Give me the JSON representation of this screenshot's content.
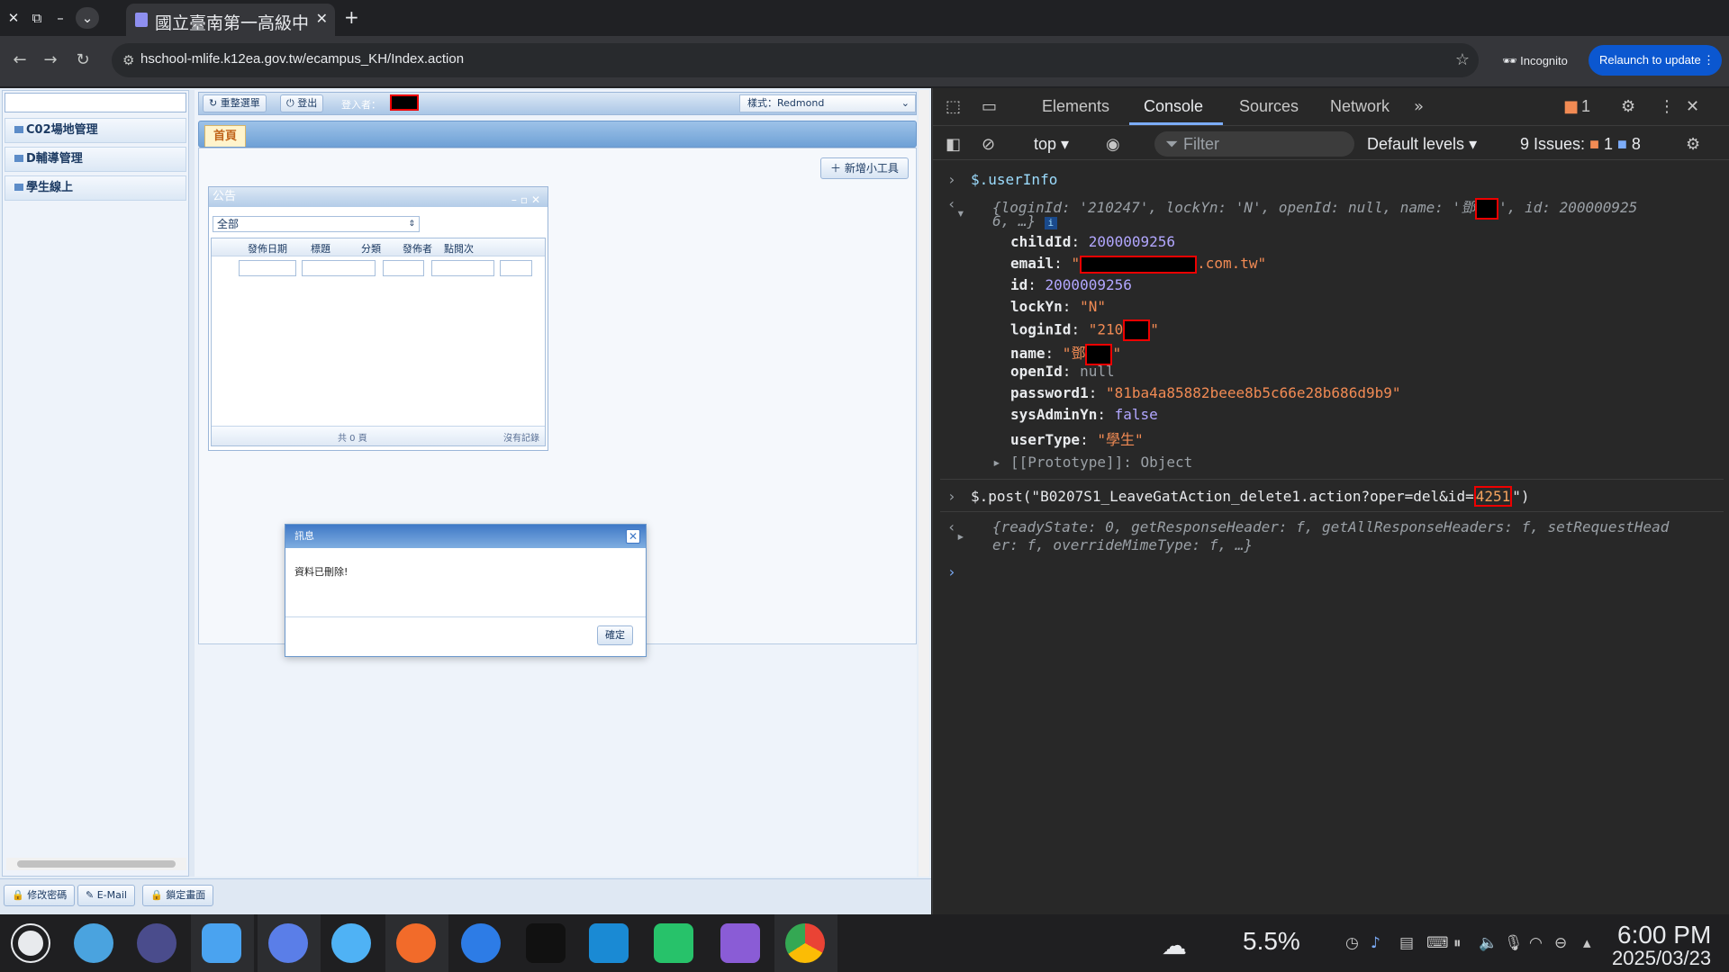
{
  "browser": {
    "tab_title": "國立臺南第一高級中學",
    "url": "hschool-mlife.k12ea.gov.tw/ecampus_KH/Index.action",
    "incognito_label": "Incognito",
    "relaunch_label": "Relaunch to update"
  },
  "page": {
    "left_menu": [
      "C02場地管理",
      "D輔導管理",
      "學生線上"
    ],
    "topbar": {
      "reload_menu": "重整選單",
      "logout": "登出",
      "login_label": "登入者：",
      "style_select": "樣式：Redmond"
    },
    "home_tab": "首頁",
    "add_widget": "新增小工具",
    "announcement": {
      "title": "公告",
      "filter": "全部",
      "columns": [
        "發佈日期",
        "標題",
        "分類",
        "發佈者",
        "點閱次"
      ],
      "pager_text": "共 0 頁",
      "empty_text": "沒有記錄"
    },
    "bottom_buttons": [
      "修改密碼",
      "E-Mail",
      "鎖定畫面"
    ],
    "dialog": {
      "title": "訊息",
      "message": "資料已刪除!",
      "ok": "確定"
    }
  },
  "devtools": {
    "tabs": [
      "Elements",
      "Console",
      "Sources",
      "Network"
    ],
    "context": "top",
    "filter_placeholder": "Filter",
    "levels": "Default levels",
    "issues_label": "9 Issues:",
    "issues_warn": "1",
    "issues_info": "8",
    "header_warn_count": "1",
    "console": {
      "cmd1": "$.userInfo",
      "summary_pre": "{loginId: '210247', lockYn: 'N', openId: null, name: '鄧",
      "summary_post": "', id: 200000925",
      "summary_line2": "6, …}",
      "props": [
        {
          "key": "childId",
          "value": "2000009256",
          "kind": "num"
        },
        {
          "key": "email",
          "value": ".com.tw\"",
          "kind": "email"
        },
        {
          "key": "id",
          "value": "2000009256",
          "kind": "num"
        },
        {
          "key": "lockYn",
          "value": "\"N\"",
          "kind": "str"
        },
        {
          "key": "loginId",
          "value": "\"210",
          "kind": "loginid"
        },
        {
          "key": "name",
          "value": "\"鄧",
          "kind": "name"
        },
        {
          "key": "openId",
          "value": "null",
          "kind": "null"
        },
        {
          "key": "password1",
          "value": "\"81ba4a85882beee8b5c66e28b686d9b9\"",
          "kind": "str"
        },
        {
          "key": "sysAdminYn",
          "value": "false",
          "kind": "num"
        },
        {
          "key": "userType",
          "value": "\"學生\"",
          "kind": "str"
        }
      ],
      "proto": "[[Prototype]]: Object",
      "cmd2_pre": "$.post(\"B0207S1_LeaveGatAction_delete1.action?oper=del&id=",
      "cmd2_id": "4251",
      "cmd2_post": "\")",
      "result_line1": "{readyState: 0, getResponseHeader: f, getAllResponseHeaders: f, setRequestHead",
      "result_line2": "er: f, overrideMimeType: f, …}"
    }
  },
  "tray": {
    "battery": "5.5%",
    "time": "6:00 PM",
    "date": "2025/03/23"
  },
  "colors": {
    "console_num": "#b2a7ff",
    "console_string": "#f28b54",
    "accent": "#7cacf8"
  }
}
